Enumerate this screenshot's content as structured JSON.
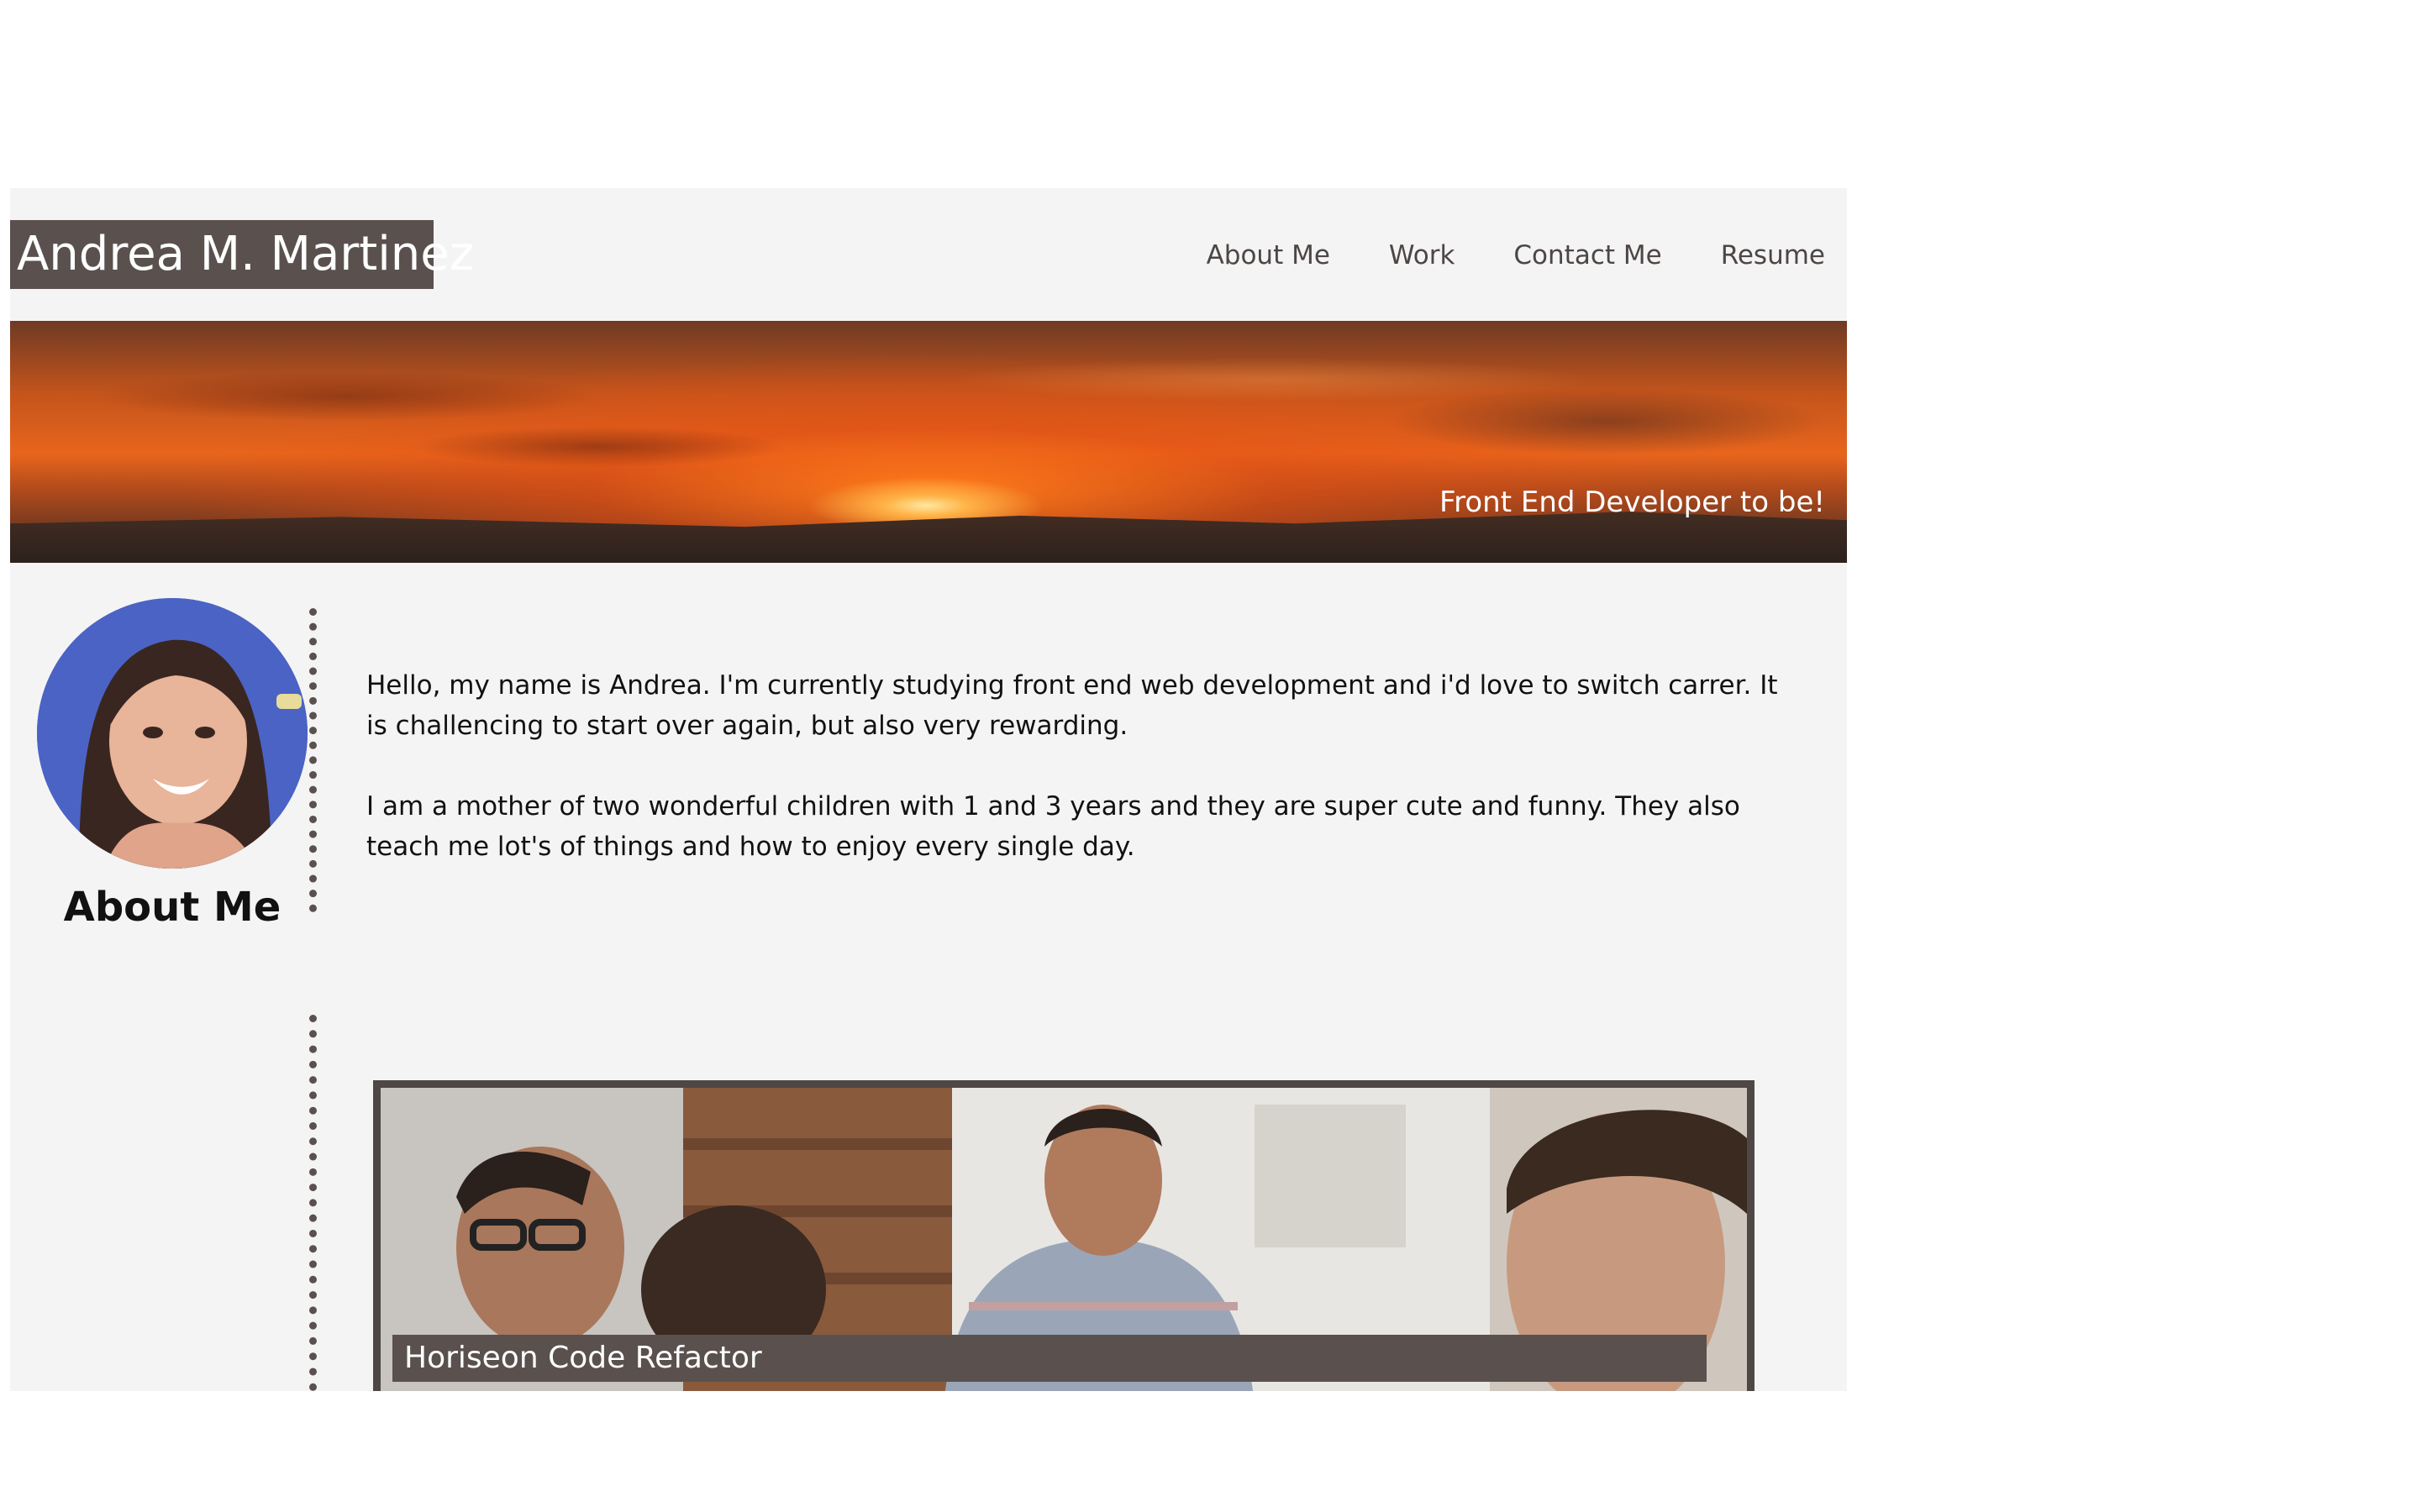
{
  "header": {
    "brand": "Andrea M. Martinez",
    "nav": [
      "About Me",
      "Work",
      "Contact Me",
      "Resume"
    ]
  },
  "hero": {
    "tagline": "Front End Developer to be!"
  },
  "about": {
    "heading": "About Me",
    "paragraphs": [
      "Hello, my name is Andrea. I'm currently studying front end web development and i'd love to switch carrer. It is challencing to start over again, but also very rewarding.",
      "I am a mother of two wonderful children with 1 and 3 years and they are super cute and funny. They also teach me lot's of things and how to enjoy every single day."
    ]
  },
  "work": {
    "projects": [
      {
        "title": "Horiseon Code Refactor"
      }
    ]
  },
  "colors": {
    "brand_bg": "#5a514f",
    "page_bg": "#f4f4f4",
    "nav_text": "#4c4644",
    "accent_dots": "#5a514f"
  }
}
